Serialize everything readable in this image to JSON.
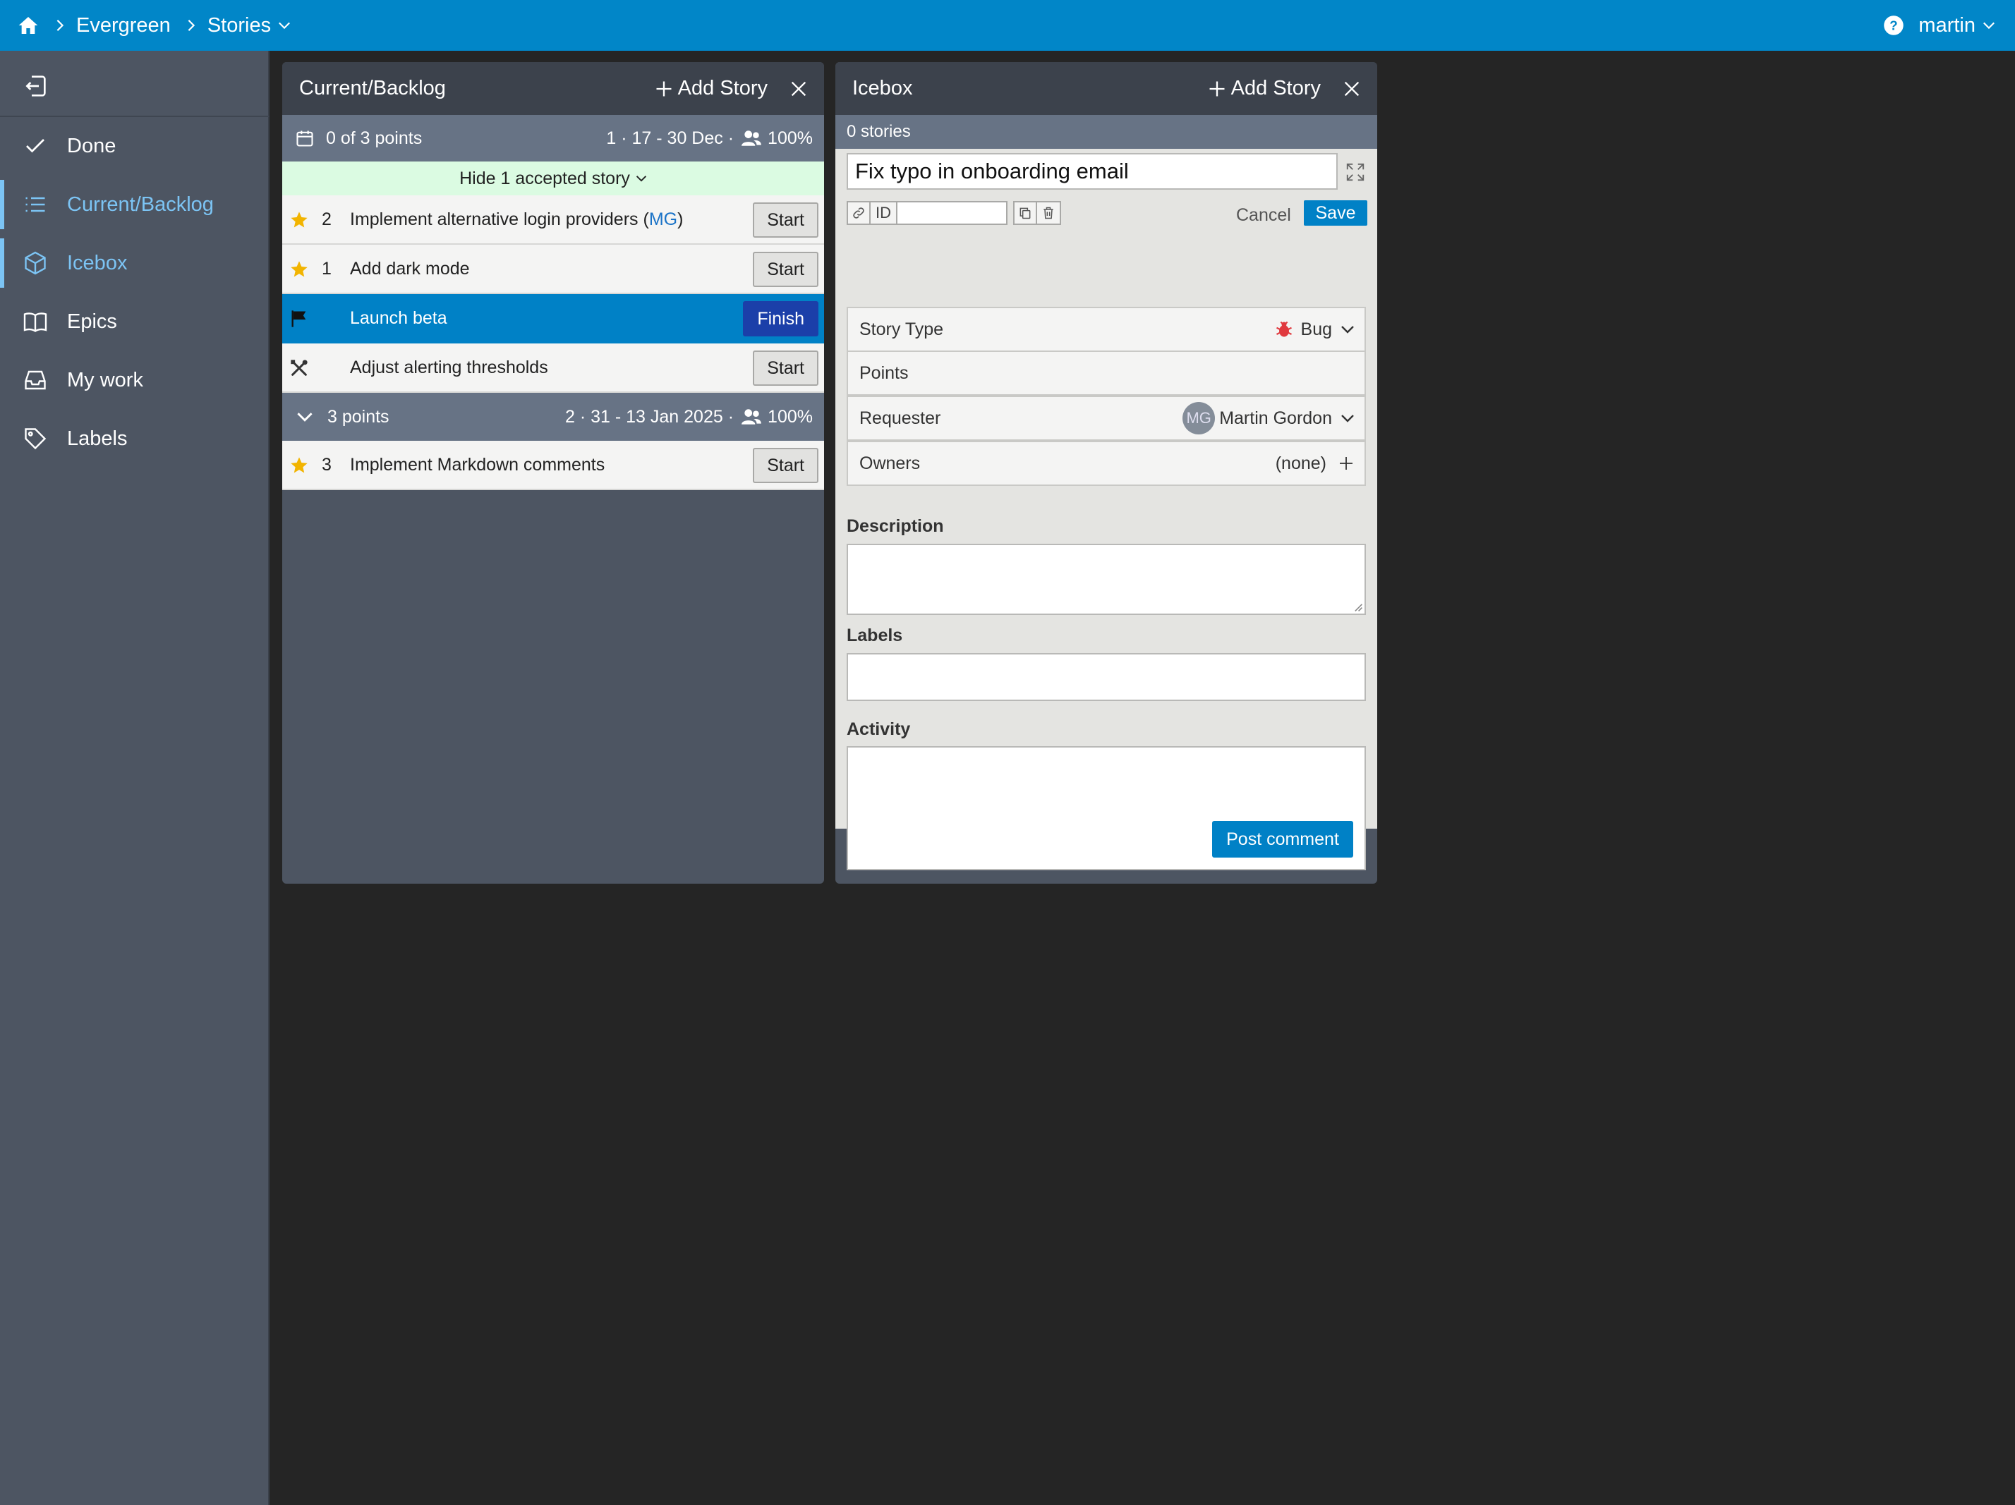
{
  "topbar": {
    "project": "Evergreen",
    "section": "Stories",
    "user": "martin"
  },
  "sidebar": {
    "items": [
      {
        "label": "Done",
        "icon": "check-icon"
      },
      {
        "label": "Current/Backlog",
        "icon": "list-icon"
      },
      {
        "label": "Icebox",
        "icon": "cube-icon"
      },
      {
        "label": "Epics",
        "icon": "book-icon"
      },
      {
        "label": "My work",
        "icon": "inbox-icon"
      },
      {
        "label": "Labels",
        "icon": "tag-icon"
      }
    ],
    "active": [
      "Current/Backlog",
      "Icebox"
    ]
  },
  "current": {
    "title": "Current/Backlog",
    "add_label": "Add Story",
    "iteration1": {
      "points": "0 of 3 points",
      "info": "1 · 17 - 30 Dec ·",
      "capacity": "100%"
    },
    "accepted_toggle": "Hide 1 accepted story",
    "stories": [
      {
        "type": "feature",
        "points": "2",
        "title_pre": "Implement alternative login providers (",
        "owner": "MG",
        "title_post": ")",
        "button": "Start"
      },
      {
        "type": "feature",
        "points": "1",
        "title": "Add dark mode",
        "button": "Start"
      },
      {
        "type": "release",
        "points": "",
        "title": "Launch beta",
        "button": "Finish"
      },
      {
        "type": "chore",
        "points": "",
        "title": "Adjust alerting thresholds",
        "button": "Start"
      }
    ],
    "iteration2": {
      "points": "3 points",
      "info": "2 · 31 - 13 Jan 2025 ·",
      "capacity": "100%"
    },
    "stories2": [
      {
        "type": "feature",
        "points": "3",
        "title": "Implement Markdown comments",
        "button": "Start"
      }
    ]
  },
  "icebox": {
    "title": "Icebox",
    "add_label": "Add Story",
    "count": "0 stories",
    "editor": {
      "title_value": "Fix typo in onboarding email",
      "id_label": "ID",
      "cancel": "Cancel",
      "save": "Save",
      "story_type_label": "Story Type",
      "story_type_value": "Bug",
      "points_label": "Points",
      "requester_label": "Requester",
      "requester_initials": "MG",
      "requester_name": "Martin Gordon",
      "owners_label": "Owners",
      "owners_value": "(none)",
      "description_label": "Description",
      "labels_label": "Labels",
      "activity_label": "Activity",
      "post_comment": "Post comment"
    }
  },
  "colors": {
    "topbar": "#0186c8",
    "sidebar": "#4d5562",
    "active_nav": "#7cc4f4",
    "selected_story": "#0081c6",
    "finish_button": "#1b3fa9",
    "accepted_bg": "#dbfbe2",
    "star": "#f2b400",
    "bug": "#e0393e"
  }
}
